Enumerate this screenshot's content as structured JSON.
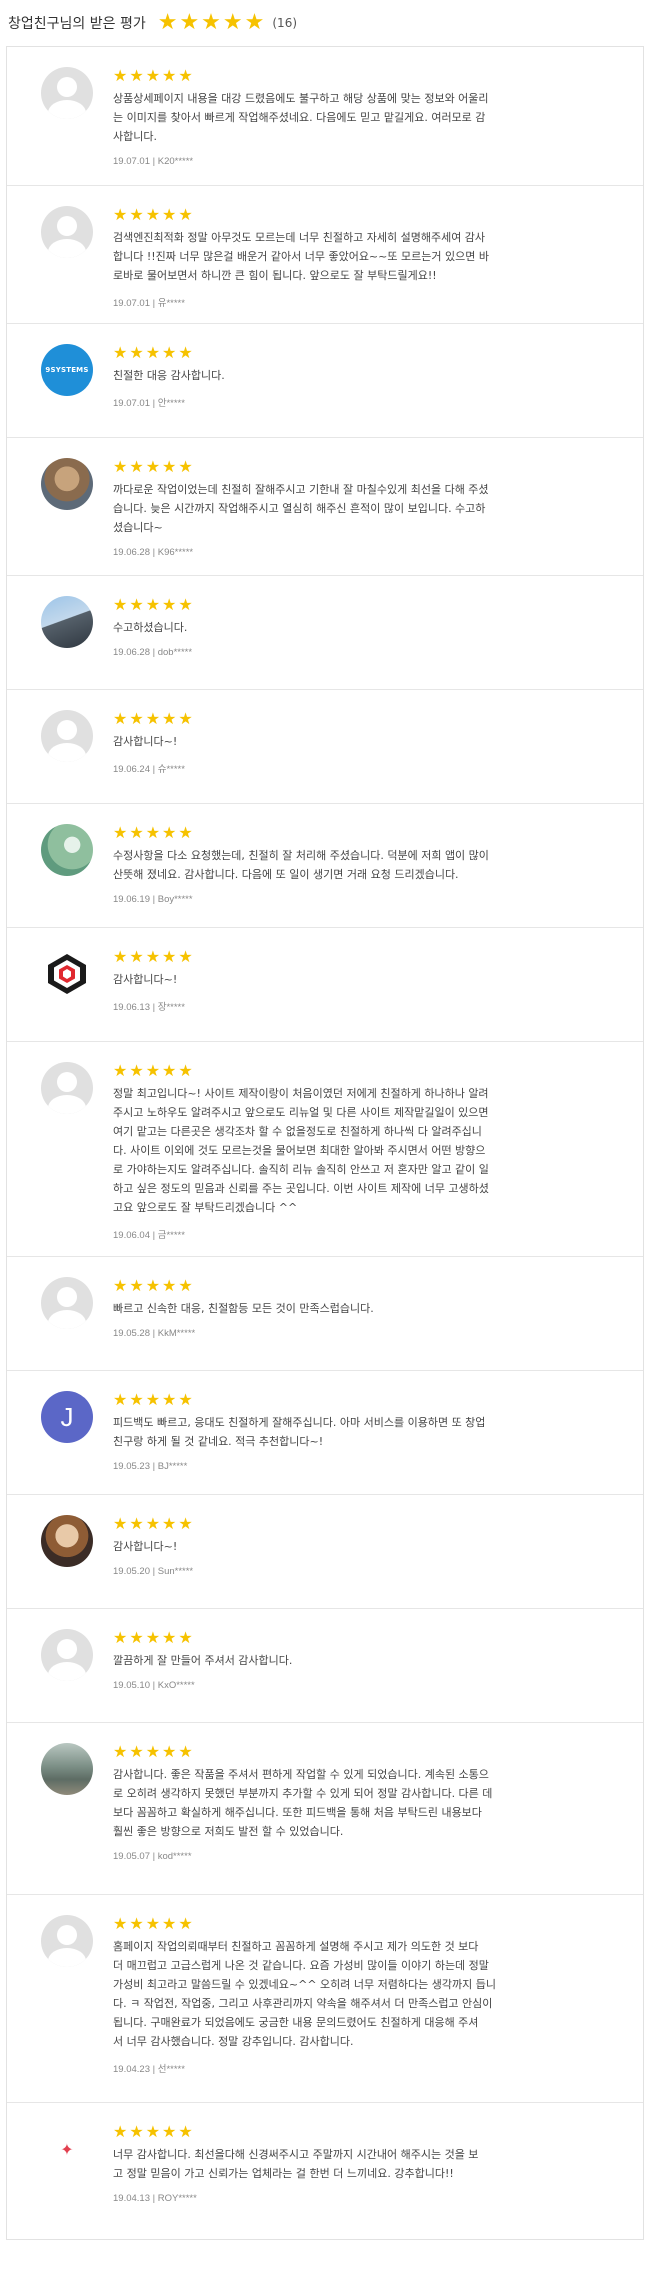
{
  "header": {
    "title": "창업친구님의 받은 평가",
    "count": "(16)",
    "rating_stars": 5
  },
  "colors": {
    "star": "#f6c200",
    "border": "#e2e2e2"
  },
  "reviews": [
    {
      "avatar": "default",
      "text": "상품상세페이지 내용을 대강 드렸음에도 불구하고 해당 상품에 맞는 정보와 어울리\n는 이미지를 찾아서 빠르게 작업해주셨네요. 다음에도 믿고 맡길게요. 여러모로 감\n사합니다.",
      "meta": "19.07.01 | K20*****",
      "height": 139
    },
    {
      "avatar": "default",
      "text": "검색엔진최적화 정말 아무것도 모르는데 너무 친절하고 자세히 설명해주세여 감사\n합니다 !!진짜 너무 많은걸 배운거 같아서 너무 좋았어요~~또 모르는거 있으면 바\n로바로 물어보면서 하니깐 큰 힘이 됩니다. 앞으로도 잘 부탁드릴게요!!",
      "meta": "19.07.01 | 유*****",
      "height": 138
    },
    {
      "avatar": "blue",
      "avatar_text": "9SYSTEMS",
      "text": "친절한 대응 감사합니다.",
      "meta": "19.07.01 | 안*****",
      "height": 114
    },
    {
      "avatar": "photo1",
      "text": "까다로운 작업이었는데 친절히 잘해주시고 기한내 잘 마칠수있게 최선을 다해 주셨\n습니다. 늦은 시간까지 작업해주시고 열심히 해주신 흔적이 많이 보입니다. 수고하\n셨습니다~",
      "meta": "19.06.28 | K96*****",
      "height": 138
    },
    {
      "avatar": "photo2",
      "text": "수고하셨습니다.",
      "meta": "19.06.28 | dob*****",
      "height": 114
    },
    {
      "avatar": "default",
      "text": "감사합니다~!",
      "meta": "19.06.24 | 슈*****",
      "height": 114
    },
    {
      "avatar": "photo3",
      "text": "수정사항을 다소 요청했는데, 친절히 잘 처리해 주셨습니다. 덕분에 저희 앱이 많이\n산뜻해 졌네요. 감사합니다. 다음에 또 일이 생기면 거래 요청 드리겠습니다.",
      "meta": "19.06.19 | Boy*****",
      "height": 124
    },
    {
      "avatar": "logo",
      "text": "감사합니다~!",
      "meta": "19.06.13 | 장*****",
      "height": 114
    },
    {
      "avatar": "default",
      "text": "정말 최고입니다~! 사이트 제작이랑이 처음이였던 저에게 친절하게 하나하나 알려\n주시고 노하우도 알려주시고 앞으로도 리뉴얼 및 다른 사이트 제작맡길일이 있으면\n여기 맡고는 다른곳은 생각조차 할 수 없을정도로 친절하게 하나씩 다 알려주십니\n다. 사이트 이외에 것도 모르는것을 물어보면 최대한 알아봐 주시면서 어떤 방향으\n로 가야하는지도 알려주십니다. 솔직히 리뉴 솔직히 안쓰고 저 혼자만 알고 같이 일\n하고 싶은 정도의 믿음과 신뢰를 주는 곳입니다. 이번 사이트 제작에 너무 고생하셨\n고요 앞으로도 잘 부탁드리겠습니다 ^^",
      "meta": "19.06.04 | 금*****",
      "height": 215
    },
    {
      "avatar": "default",
      "text": "빠르고 신속한 대응, 친절함등 모든 것이 만족스럽습니다.",
      "meta": "19.05.28 | KkM*****",
      "height": 114
    },
    {
      "avatar": "letter",
      "avatar_text": "J",
      "text": "피드백도 빠르고, 응대도 친절하게 잘해주십니다. 아마 서비스를 이용하면 또 창업\n친구랑 하게 될 것 같네요. 적극 추천합니다~!",
      "meta": "19.05.23 | BJ*****",
      "height": 124
    },
    {
      "avatar": "photo4",
      "text": "감사합니다~!",
      "meta": "19.05.20 | Sun*****",
      "height": 114
    },
    {
      "avatar": "default",
      "text": "깔끔하게 잘 만들어 주셔서 감사합니다.",
      "meta": "19.05.10 | KxO*****",
      "height": 114
    },
    {
      "avatar": "photo5",
      "text": "감사합니다. 좋은 작품을 주셔서 편하게 작업할 수 있게 되었습니다. 계속된 소통으\n로 오히려 생각하지 못했던 부분까지 추가할 수 있게 되어 정말 감사합니다. 다른 데\n보다 꼼꼼하고 확실하게 해주십니다. 또한 피드백을 통해 처음 부탁드린 내용보다\n훨씬 좋은 방향으로 저희도 발전 할 수 있었습니다.",
      "meta": "19.05.07 | kod*****",
      "height": 172
    },
    {
      "avatar": "default",
      "text": "홈페이지 작업의뢰때부터 친절하고 꼼꼼하게 설명해 주시고 제가 의도한 것 보다\n더 매끄럽고 고급스럽게 나온 것 같습니다. 요즘 가성비 많이들 이야기 하는데 정말\n가성비 최고라고 말씀드릴 수 있겠네요~^^ 오히려 너무 저렴하다는 생각까지 듭니\n다. ㅋ 작업전, 작업중, 그리고 사후관리까지 약속을 해주셔서 더 만족스럽고 안심이\n됩니다. 구매완료가 되었음에도 궁금한 내용 문의드렸어도 친절하게 대응해 주셔\n서 너무 감사했습니다. 정말 강추입니다. 감사합니다.",
      "meta": "19.04.23 | 선*****",
      "height": 208
    },
    {
      "avatar": "flamingo",
      "text": "너무 감사합니다. 최선을다해 신경써주시고 주말까지 시간내어 해주시는 것을 보\n고 정말 믿음이 가고 신뢰가는 업체라는 걸 한번 더 느끼네요. 강추합니다!!",
      "meta": "19.04.13 | ROY*****",
      "height": 136
    }
  ]
}
